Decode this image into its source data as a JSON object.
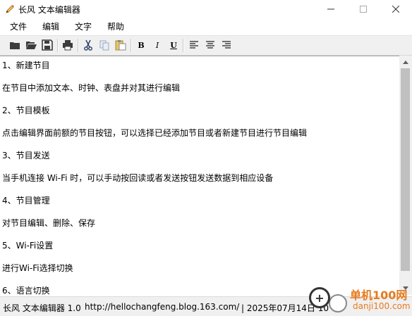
{
  "window": {
    "title": "长风 文本编辑器",
    "minimize_glyph": "—",
    "maximize_glyph": "☐",
    "close_glyph": "✕"
  },
  "menu": [
    "文件",
    "编辑",
    "文字",
    "帮助"
  ],
  "toolbar": {
    "bold_label": "B",
    "italic_label": "I",
    "underline_label": "U",
    "icons": [
      "new-icon",
      "open-icon",
      "save-icon",
      "print-icon",
      "cut-icon",
      "copy-icon",
      "paste-icon",
      "bold-icon",
      "italic-icon",
      "underline-icon",
      "align-left-icon",
      "align-center-icon",
      "align-right-icon"
    ]
  },
  "editor": {
    "lines": [
      "1、新建节目",
      "在节目中添加文本、时钟、表盘并对其进行编辑",
      "2、节目模板",
      "点击编辑界面前额的节目按钮，可以选择已经添加节目或者新建节目进行节目编辑",
      "3、节目发送",
      "当手机连接 Wi-Fi 时，可以手动按回读或者发送按钮发送数据到相应设备",
      "4、节目管理",
      "对节目编辑、删除、保存",
      "5、Wi-Fi设置",
      "进行Wi-Fi选择切换",
      "6、语言切换"
    ]
  },
  "statusbar": {
    "app": "长风 文本编辑器 1.0",
    "url": "http://hellochangfeng.blog.163.com/",
    "datetime": "| 2025年07月14日 10"
  },
  "watermark": {
    "brand": "单机100网",
    "domain": "danji100.com"
  },
  "colors": {
    "watermark_orange": "#e87a1c"
  }
}
